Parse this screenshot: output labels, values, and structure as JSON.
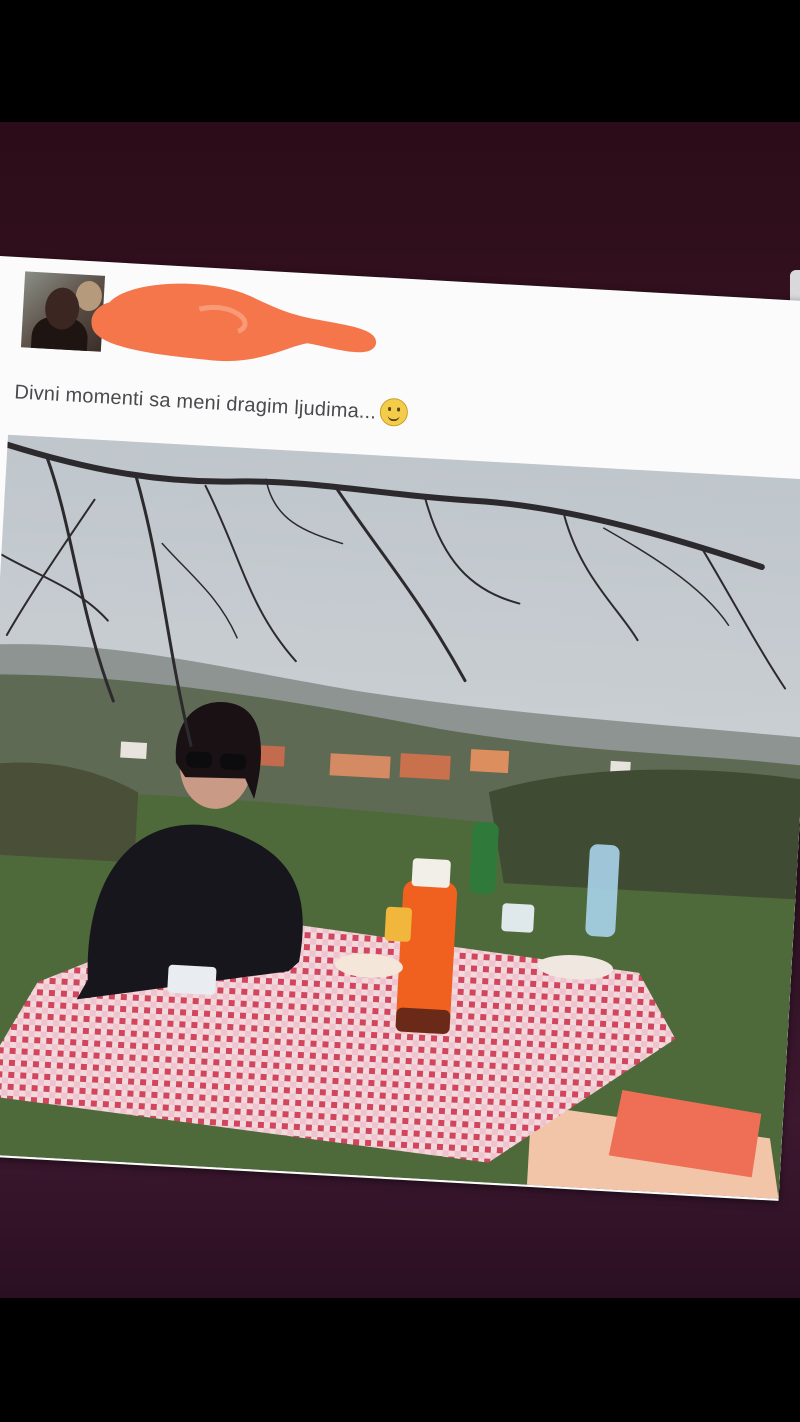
{
  "post": {
    "caption": "Divni momenti sa meni dragim ljudima...",
    "emoji": "smiling-face-emoji"
  },
  "colors": {
    "redaction": "#f4764a",
    "tablecloth": "#d9566a",
    "thermos": "#f0601e",
    "sky": "#c9ced4",
    "grass": "#4f6a39"
  }
}
